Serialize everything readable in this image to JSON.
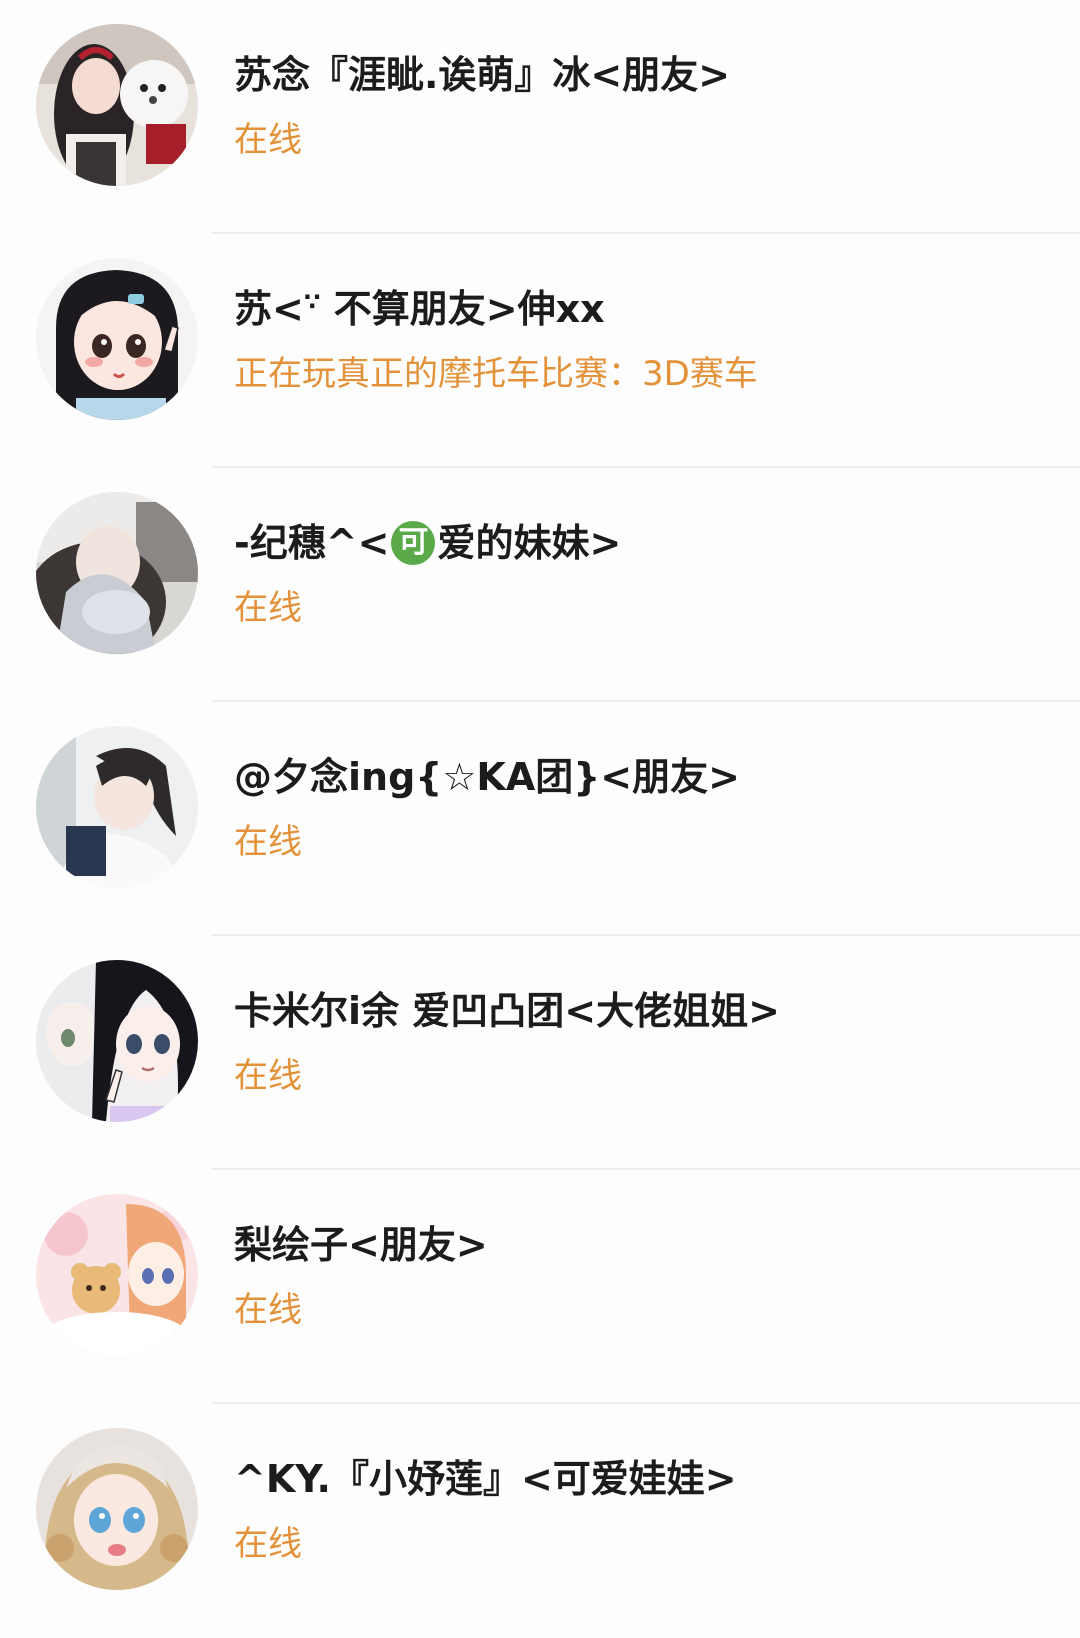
{
  "friends": [
    {
      "name": "苏念『涯眦.诶萌』冰<朋友>",
      "status": "在线",
      "avatar_icon": "girl-with-white-dog-photo-icon"
    },
    {
      "name_before": "苏<",
      "name_emoji": "∵",
      "name_after": " 不算朋友>伸xx",
      "status": "正在玩真正的摩托车比赛：3D赛车",
      "avatar_icon": "cartoon-girl-peace-sign-icon"
    },
    {
      "name_before": "-纪穗^<",
      "name_badge": "可",
      "name_after": "爱的妹妹>",
      "status": "在线",
      "avatar_icon": "girl-covering-face-photo-icon"
    },
    {
      "name": "@夕念ing{☆KA团}<朋友>",
      "status": "在线",
      "avatar_icon": "girl-ponytail-photo-icon"
    },
    {
      "name": "卡米尔i余 爱凹凸团<大佬姐姐>",
      "status": "在线",
      "avatar_icon": "anime-twins-black-white-hair-icon"
    },
    {
      "name": "梨绘子<朋友>",
      "status": "在线",
      "avatar_icon": "anime-girl-teddy-bear-pink-icon"
    },
    {
      "name": "^KY.『小妤莲』<可爱娃娃>",
      "status": "在线",
      "avatar_icon": "doll-blonde-curls-icon"
    }
  ],
  "colors": {
    "status_orange": "#e3923a",
    "name_text": "#1c1c1c",
    "divider": "#ececec",
    "badge_green": "#5aaa4a"
  }
}
